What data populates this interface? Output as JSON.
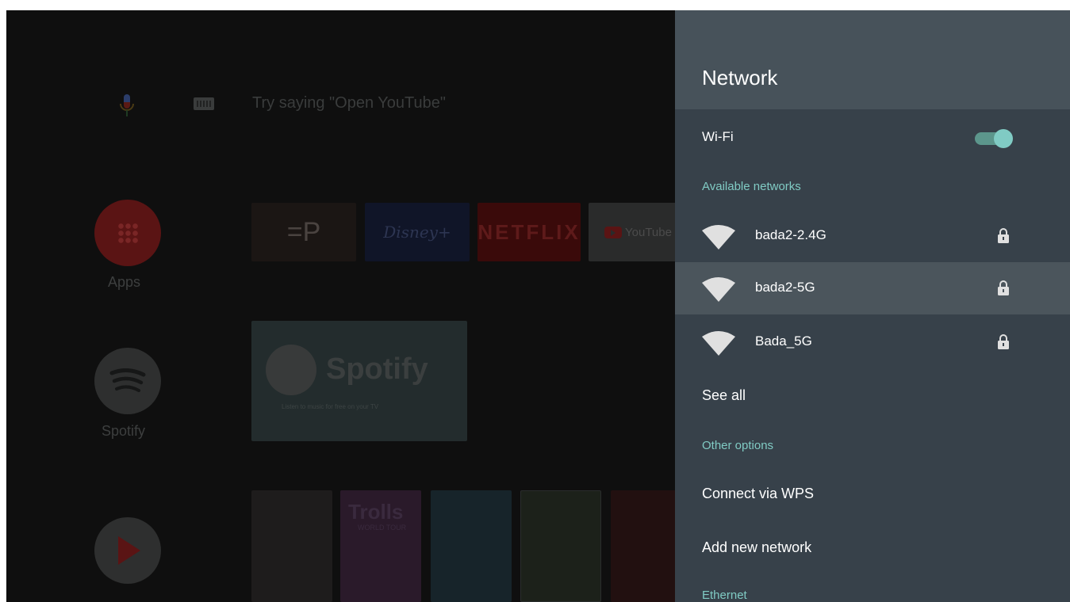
{
  "launcher": {
    "search_hint": "Try saying \"Open YouTube\"",
    "side_apps": [
      {
        "label": "Apps",
        "icon": "apps-grid-icon"
      },
      {
        "label": "Spotify",
        "icon": "spotify-icon"
      },
      {
        "label": "",
        "icon": "play-movies-icon"
      }
    ],
    "app_tiles": [
      "=P",
      "Disney+",
      "NETFLIX",
      "YouTube"
    ],
    "banner": {
      "title": "Spotify",
      "subtitle": "Listen to music for free on your TV"
    },
    "posters": [
      "",
      "Trolls",
      "",
      "",
      ""
    ],
    "poster_sub": "WORLD TOUR"
  },
  "panel": {
    "title": "Network",
    "wifi": {
      "label": "Wi-Fi",
      "enabled": true
    },
    "available_label": "Available networks",
    "networks": [
      {
        "name": "bada2-2.4G",
        "secured": true,
        "selected": false
      },
      {
        "name": "bada2-5G",
        "secured": true,
        "selected": true
      },
      {
        "name": "Bada_5G",
        "secured": true,
        "selected": false
      }
    ],
    "see_all": "See all",
    "other_options_label": "Other options",
    "connect_wps": "Connect via WPS",
    "add_network": "Add new network",
    "ethernet_label": "Ethernet"
  },
  "colors": {
    "panel_bg": "#37414a",
    "header_bg": "#47525a",
    "selected_row": "#4b555c",
    "accent_teal": "#80cbc4"
  }
}
